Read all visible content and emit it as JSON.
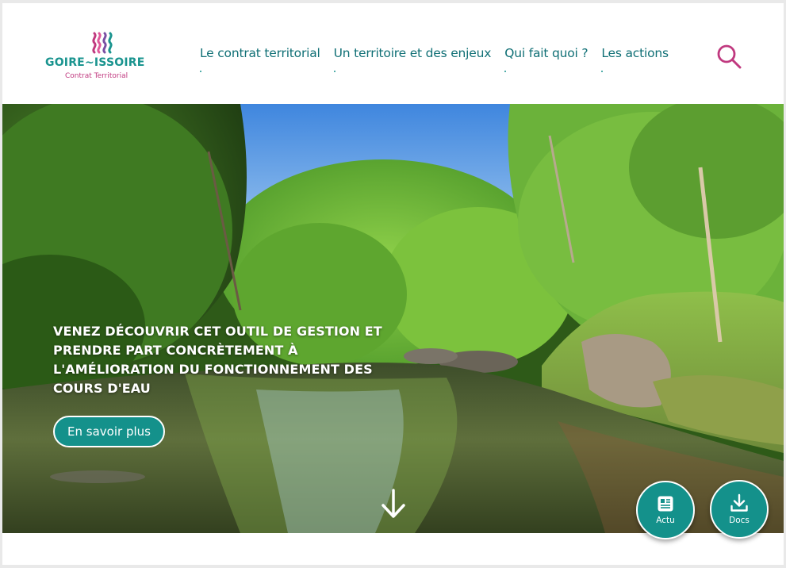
{
  "brand": {
    "name": "GOIRE~ISSOIRE",
    "subtitle": "Contrat Territorial",
    "primary_color": "#14918b",
    "accent_color": "#c0397f"
  },
  "nav": {
    "items": [
      {
        "label": "Le contrat territorial"
      },
      {
        "label": "Un territoire et des enjeux"
      },
      {
        "label": "Qui fait quoi ?"
      },
      {
        "label": "Les actions"
      }
    ],
    "search_icon": "search-icon"
  },
  "hero": {
    "title": "Venez découvrir cet outil de gestion et prendre part concrètement à l'amélioration du fonctionnement des cours d'eau",
    "button_label": "En savoir plus",
    "scroll_icon": "arrow-down-icon"
  },
  "quick_actions": {
    "actu_label": "Actu",
    "actu_icon": "newspaper-icon",
    "docs_label": "Docs",
    "docs_icon": "download-icon"
  }
}
